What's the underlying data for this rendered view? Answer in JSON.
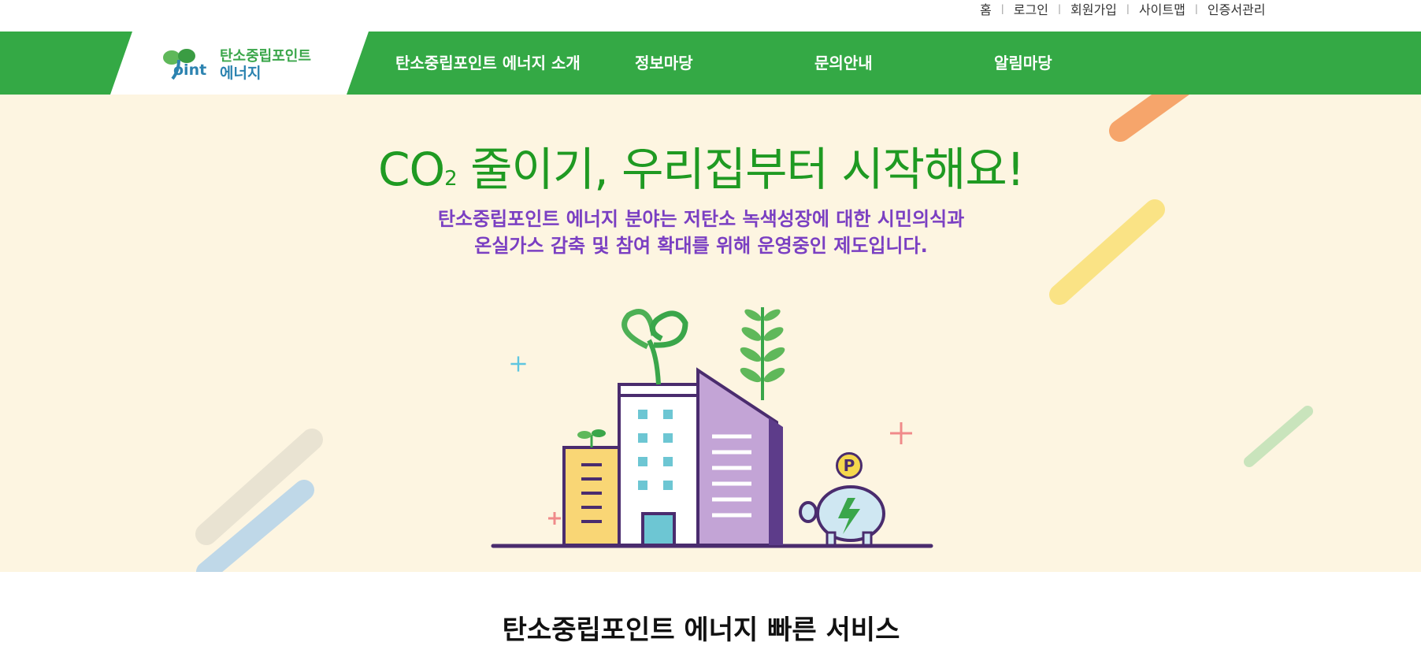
{
  "util_links": [
    "홈",
    "로그인",
    "회원가입",
    "사이트맵",
    "인증서관리"
  ],
  "logo": {
    "line1": "탄소중립포인트",
    "line2": "에너지",
    "p_text": "oint"
  },
  "nav": [
    "탄소중립포인트 에너지 소개",
    "정보마당",
    "문의안내",
    "알림마당"
  ],
  "hero": {
    "title_prefix": "CO",
    "title_sub": "2",
    "title_rest": " 줄이기, 우리집부터 시작해요!",
    "desc_line1": "탄소중립포인트 에너지 분야는 저탄소 녹색성장에 대한 시민의식과",
    "desc_line2": "온실가스 감축 및 참여 확대를 위해 운영중인 제도입니다.",
    "coin_letter": "P"
  },
  "services": {
    "title": "탄소중립포인트 에너지 빠른 서비스"
  },
  "colors": {
    "nav_green": "#34a945",
    "hero_bg": "#fdf5e1",
    "title_green": "#1f9a22",
    "desc_purple": "#7a3fc2"
  }
}
